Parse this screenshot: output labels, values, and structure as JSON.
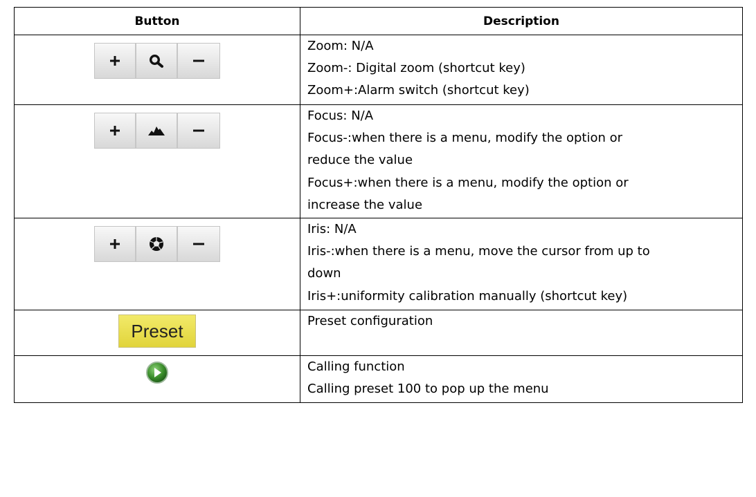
{
  "table": {
    "headers": {
      "button": "Button",
      "description": "Description"
    },
    "rows": [
      {
        "button_icons": [
          "plus-icon",
          "magnifier-icon",
          "minus-icon"
        ],
        "lines": [
          "Zoom: N/A",
          "Zoom-: Digital zoom (shortcut key)",
          "Zoom+:Alarm switch (shortcut key)"
        ]
      },
      {
        "button_icons": [
          "plus-icon",
          "mountain-icon",
          "minus-icon"
        ],
        "lines": [
          "Focus: N/A",
          "Focus-:when there is a menu, modify the option or",
          "reduce the value",
          "Focus+:when there is a menu, modify the option or",
          "increase the value"
        ]
      },
      {
        "button_icons": [
          "plus-icon",
          "aperture-icon",
          "minus-icon"
        ],
        "lines": [
          "Iris: N/A",
          "Iris-:when there is a menu, move the cursor from up to",
          "down",
          "Iris+:uniformity calibration manually (shortcut key)"
        ]
      },
      {
        "button_label": "Preset",
        "lines": [
          "Preset configuration"
        ]
      },
      {
        "button_icons": [
          "play-icon"
        ],
        "lines": [
          "Calling function",
          "Calling preset 100 to pop up the menu"
        ]
      }
    ]
  },
  "colors": {
    "border": "#000000",
    "preset_yellow": "#e8dd4f",
    "play_green": "#3c8f2c"
  }
}
